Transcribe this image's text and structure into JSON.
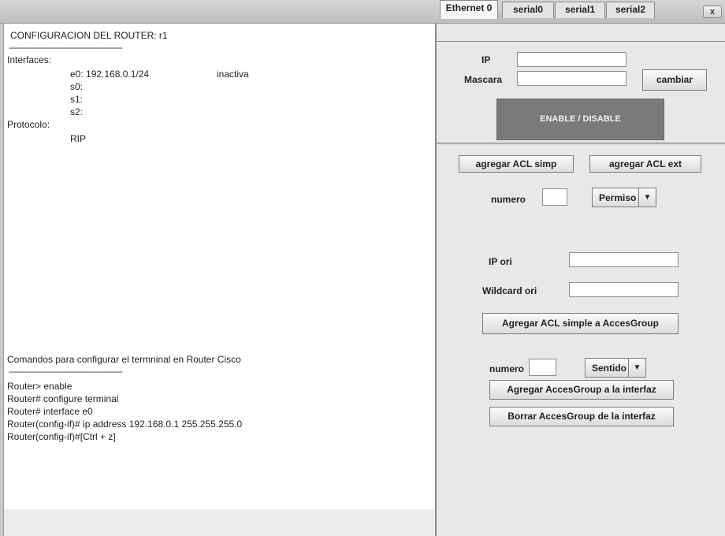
{
  "window": {
    "close_label": "x"
  },
  "config": {
    "title": "CONFIGURACION DEL ROUTER: r1",
    "separator": "------------------------------------------------------",
    "interfaces_label": "Interfaces:",
    "interfaces": [
      {
        "text": "e0: 192.168.0.1/24",
        "status": "inactiva"
      },
      {
        "text": "s0:",
        "status": ""
      },
      {
        "text": "s1:",
        "status": ""
      },
      {
        "text": "s2:",
        "status": ""
      }
    ],
    "protocol_label": "Protocolo:",
    "protocol": "RIP"
  },
  "commands": {
    "title": "Comandos para configurar el termninal en Router Cisco",
    "separator": "------------------------------------------------------",
    "lines": [
      "Router> enable",
      "Router# configure terminal",
      "Router# interface e0",
      "Router(config-if)# ip address 192.168.0.1 255.255.255.0",
      "Router(config-if)#[Ctrl + z]"
    ]
  },
  "tabs": [
    "Ethernet 0",
    "serial0",
    "serial1",
    "serial2"
  ],
  "iface_form": {
    "ip_label": "IP",
    "mask_label": "Mascara",
    "ip_value": "",
    "mask_value": "",
    "change_button": "cambiar",
    "enable_button": "ENABLE / DISABLE"
  },
  "acl": {
    "add_simple": "agregar ACL simp",
    "add_ext": "agregar ACL ext",
    "numero_label": "numero",
    "numero_value": "",
    "permiso": "Permiso",
    "ip_ori_label": "IP ori",
    "ip_ori_value": "",
    "wildcard_label": "Wildcard ori",
    "wildcard_value": "",
    "add_to_group": "Agregar ACL simple a AccesGroup",
    "numero2_label": "numero",
    "numero2_value": "",
    "sentido": "Sentido",
    "add_group_iface": "Agregar AccesGroup a la interfaz",
    "del_group_iface": "Borrar AccesGroup de la interfaz"
  }
}
